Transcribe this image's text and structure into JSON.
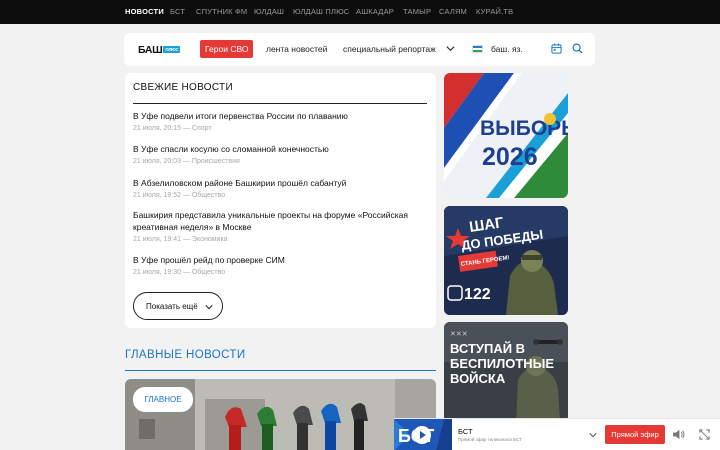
{
  "topnav": [
    "НОВОСТИ",
    "БСТ",
    "СПУТНИК ФМ",
    "ЮЛДАШ",
    "ЮЛДАШ ПЛЮС",
    "АШКАДАР",
    "ТАМЫР",
    "САЛЯМ",
    "КУРАЙ.ТВ"
  ],
  "header": {
    "logo": "БАШ",
    "logo_badge": "ПЛЮС",
    "heroes_button": "Герои СВО",
    "news_feed": "лента новостей",
    "special_report": "специальный репортаж",
    "language": "баш. яз."
  },
  "fresh_news": {
    "title": "СВЕЖИЕ НОВОСТИ",
    "items": [
      {
        "title": "В Уфе подвели итоги первенства России по плаванию",
        "meta": "21 июля, 20:15 —  Спорт"
      },
      {
        "title": "В Уфе спасли косулю со сломанной конечностью",
        "meta": "21 июля, 20:03 —  Происшествия"
      },
      {
        "title": "В Абзелиловском районе Башкирии прошёл сабантуй",
        "meta": "21 июля, 19:52 —  Общество"
      },
      {
        "title": "Башкирия представила уникальные проекты на форуме «Российская креативная неделя» в Москве",
        "meta": "21 июля, 19:41 —  Экономика"
      },
      {
        "title": "В Уфе прошёл рейд по проверке СИМ",
        "meta": "21 июля, 19:30 —  Общество"
      }
    ],
    "more_button": "Показать ещё"
  },
  "main_news": {
    "title": "ГЛАВНЫЕ НОВОСТИ",
    "badge": "ГЛАВНОЕ"
  },
  "banners": {
    "elections": {
      "line1": "ВЫБОРЫ",
      "line2": "2026"
    },
    "victory": {
      "line1": "ШАГ",
      "line2": "ДО ПОБЕДЫ",
      "slogan": "СТАНЬ ГЕРОЕМ!",
      "phone": "122"
    },
    "drones": {
      "line1": "ВСТУПАЙ В",
      "line2": "БЕСПИЛОТНЫЕ",
      "line3": "ВОЙСКА"
    }
  },
  "player": {
    "channel": "БСТ",
    "subtitle": "Прямой эфир телеканала БСТ",
    "live_button": "Прямой эфир"
  },
  "colors": {
    "accent_red": "#e53935",
    "accent_blue": "#1a76c2",
    "topbar": "#0d0d0d"
  }
}
